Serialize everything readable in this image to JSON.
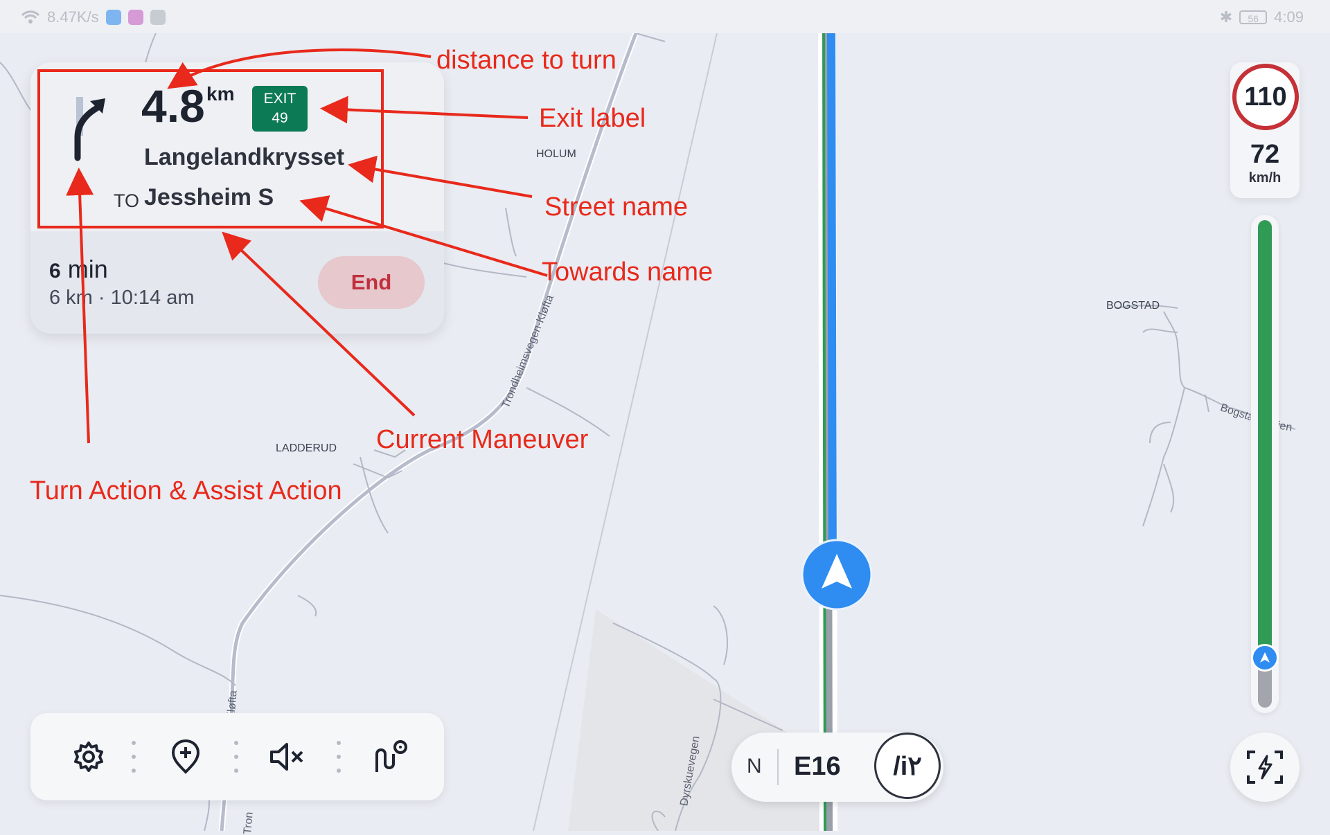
{
  "status_bar": {
    "network_speed": "8.47K/s",
    "battery": "56",
    "time": "4:09"
  },
  "map_labels": {
    "holum": "HOLUM",
    "ladderud": "LADDERUD",
    "bogstad": "BOGSTAD",
    "trondheimsvegen": "Trondheimsvegen-Kløfta",
    "klofta": "Kløfta",
    "tron": "Tron",
    "dyrskuevegen": "Dyrskuevegen",
    "bogsta_left": "Bogsta",
    "bogsta_right": "ien"
  },
  "maneuver": {
    "distance": "4.8",
    "distance_unit": "km",
    "exit_label": "EXIT",
    "exit_number": "49",
    "street": "Langelandkrysset",
    "to_prefix": "TO",
    "towards": "Jessheim S"
  },
  "trip": {
    "minutes": "6",
    "minutes_unit": "min",
    "detail": "6 km · 10:14 am",
    "end_label": "End",
    "progress": 0.9
  },
  "speed": {
    "limit": "110",
    "current": "72",
    "unit": "km/h"
  },
  "road": {
    "direction": "N",
    "name": "E16",
    "shield": "/i٢"
  },
  "toolbar": {
    "items": [
      "gear-icon",
      "add-place-icon",
      "mute-icon",
      "route-options-icon"
    ]
  },
  "annotations": {
    "distance": "distance to turn",
    "exit": "Exit label",
    "street": "Street name",
    "towards": "Towards name",
    "maneuver": "Current Maneuver",
    "turn": "Turn Action & Assist Action"
  },
  "colors": {
    "annotation": "#e8291b",
    "route_blue": "#2f8cf0",
    "progress_green": "#2f9b55",
    "exit_sign": "#0d7a56",
    "speed_limit_ring": "#c43137",
    "end_button": "#c0303f"
  }
}
